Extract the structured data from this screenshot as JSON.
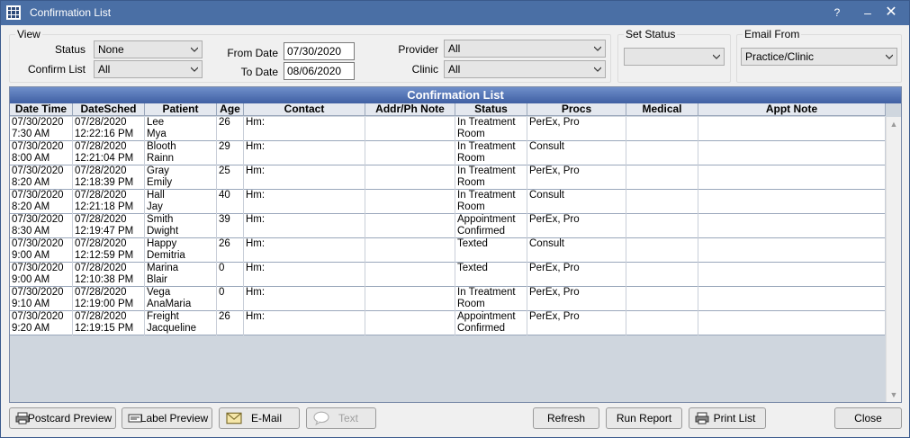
{
  "window": {
    "title": "Confirmation List",
    "help": "?",
    "minimize": "–",
    "close": "✕"
  },
  "view": {
    "group_label": "View",
    "status_label": "Status",
    "status_value": "None",
    "confirm_list_label": "Confirm List",
    "confirm_list_value": "All",
    "from_date_label": "From Date",
    "from_date_value": "07/30/2020",
    "to_date_label": "To Date",
    "to_date_value": "08/06/2020",
    "provider_label": "Provider",
    "provider_value": "All",
    "clinic_label": "Clinic",
    "clinic_value": "All"
  },
  "set_status": {
    "group_label": "Set Status",
    "value": ""
  },
  "email_from": {
    "group_label": "Email From",
    "value": "Practice/Clinic"
  },
  "grid": {
    "title": "Confirmation List",
    "columns": [
      "Date Time",
      "DateSched",
      "Patient",
      "Age",
      "Contact",
      "Addr/Ph Note",
      "Status",
      "Procs",
      "Medical",
      "Appt Note"
    ],
    "rows": [
      {
        "dt1": "07/30/2020",
        "dt2": "7:30 AM",
        "ds1": "07/28/2020",
        "ds2": "12:22:16 PM",
        "p1": "Lee",
        "p2": "Mya",
        "age": "26",
        "contact": "Hm:",
        "addr": "",
        "st1": "In Treatment",
        "st2": "Room",
        "procs": "PerEx, Pro",
        "medical": "",
        "note": ""
      },
      {
        "dt1": "07/30/2020",
        "dt2": "8:00 AM",
        "ds1": "07/28/2020",
        "ds2": "12:21:04 PM",
        "p1": "Blooth",
        "p2": "Rainn",
        "age": "29",
        "contact": "Hm:",
        "addr": "",
        "st1": "In Treatment",
        "st2": "Room",
        "procs": "Consult",
        "medical": "",
        "note": ""
      },
      {
        "dt1": "07/30/2020",
        "dt2": "8:20 AM",
        "ds1": "07/28/2020",
        "ds2": "12:18:39 PM",
        "p1": "Gray",
        "p2": "Emily",
        "age": "25",
        "contact": "Hm:",
        "addr": "",
        "st1": "In Treatment",
        "st2": "Room",
        "procs": "PerEx, Pro",
        "medical": "",
        "note": ""
      },
      {
        "dt1": "07/30/2020",
        "dt2": "8:20 AM",
        "ds1": "07/28/2020",
        "ds2": "12:21:18 PM",
        "p1": "Hall",
        "p2": "Jay",
        "age": "40",
        "contact": "Hm:",
        "addr": "",
        "st1": "In Treatment",
        "st2": "Room",
        "procs": "Consult",
        "medical": "",
        "note": ""
      },
      {
        "dt1": "07/30/2020",
        "dt2": "8:30 AM",
        "ds1": "07/28/2020",
        "ds2": "12:19:47 PM",
        "p1": "Smith",
        "p2": "Dwight",
        "age": "39",
        "contact": "Hm:",
        "addr": "",
        "st1": "Appointment",
        "st2": "Confirmed",
        "procs": "PerEx, Pro",
        "medical": "",
        "note": ""
      },
      {
        "dt1": "07/30/2020",
        "dt2": "9:00 AM",
        "ds1": "07/28/2020",
        "ds2": "12:12:59 PM",
        "p1": "Happy",
        "p2": "Demitria",
        "age": "26",
        "contact": "Hm:",
        "addr": "",
        "st1": "Texted",
        "st2": "",
        "procs": "Consult",
        "medical": "",
        "note": ""
      },
      {
        "dt1": "07/30/2020",
        "dt2": "9:00 AM",
        "ds1": "07/28/2020",
        "ds2": "12:10:38 PM",
        "p1": "Marina",
        "p2": "Blair",
        "age": "0",
        "contact": "Hm:",
        "addr": "",
        "st1": "Texted",
        "st2": "",
        "procs": "PerEx, Pro",
        "medical": "",
        "note": ""
      },
      {
        "dt1": "07/30/2020",
        "dt2": "9:10 AM",
        "ds1": "07/28/2020",
        "ds2": "12:19:00 PM",
        "p1": "Vega",
        "p2": "AnaMaria",
        "age": "0",
        "contact": "Hm:",
        "addr": "",
        "st1": "In Treatment",
        "st2": "Room",
        "procs": "PerEx, Pro",
        "medical": "",
        "note": ""
      },
      {
        "dt1": "07/30/2020",
        "dt2": "9:20 AM",
        "ds1": "07/28/2020",
        "ds2": "12:19:15 PM",
        "p1": "Freight",
        "p2": "Jacqueline",
        "age": "26",
        "contact": "Hm:",
        "addr": "",
        "st1": "Appointment",
        "st2": "Confirmed",
        "procs": "PerEx, Pro",
        "medical": "",
        "note": ""
      }
    ]
  },
  "buttons": {
    "postcard_preview": "Postcard Preview",
    "label_preview": "Label Preview",
    "email": "E-Mail",
    "text": "Text",
    "refresh": "Refresh",
    "run_report": "Run Report",
    "print_list": "Print List",
    "close": "Close"
  },
  "colors": {
    "titlebar": "#4a6fa5",
    "grid_title": "#3f5fa3"
  }
}
